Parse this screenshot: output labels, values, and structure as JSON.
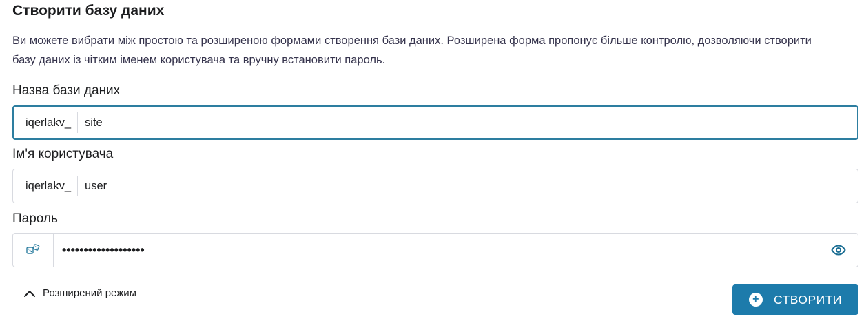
{
  "form": {
    "title": "Створити базу даних",
    "description": "Ви можете вибрати між простою та розширеною формами створення бази даних. Розширена форма пропонує більше контролю, дозволяючи створити базу даних із чітким іменем користувача та вручну встановити пароль.",
    "db_name": {
      "label": "Назва бази даних",
      "prefix": "iqerlakv_",
      "value": "site"
    },
    "username": {
      "label": "Ім'я користувача",
      "prefix": "iqerlakv_",
      "value": "user"
    },
    "password": {
      "label": "Пароль",
      "masked_value": "•••••••••••••••••••",
      "left_icon": "dice-icon",
      "right_icon": "eye-icon"
    },
    "advanced_toggle": {
      "label": "Розширений режим",
      "icon": "chevron-up-icon"
    },
    "create_button": {
      "label": "СТВОРИТИ",
      "icon": "plus-circle-icon",
      "color": "#1d7bab"
    },
    "focus_color": "#2d7ea0"
  }
}
